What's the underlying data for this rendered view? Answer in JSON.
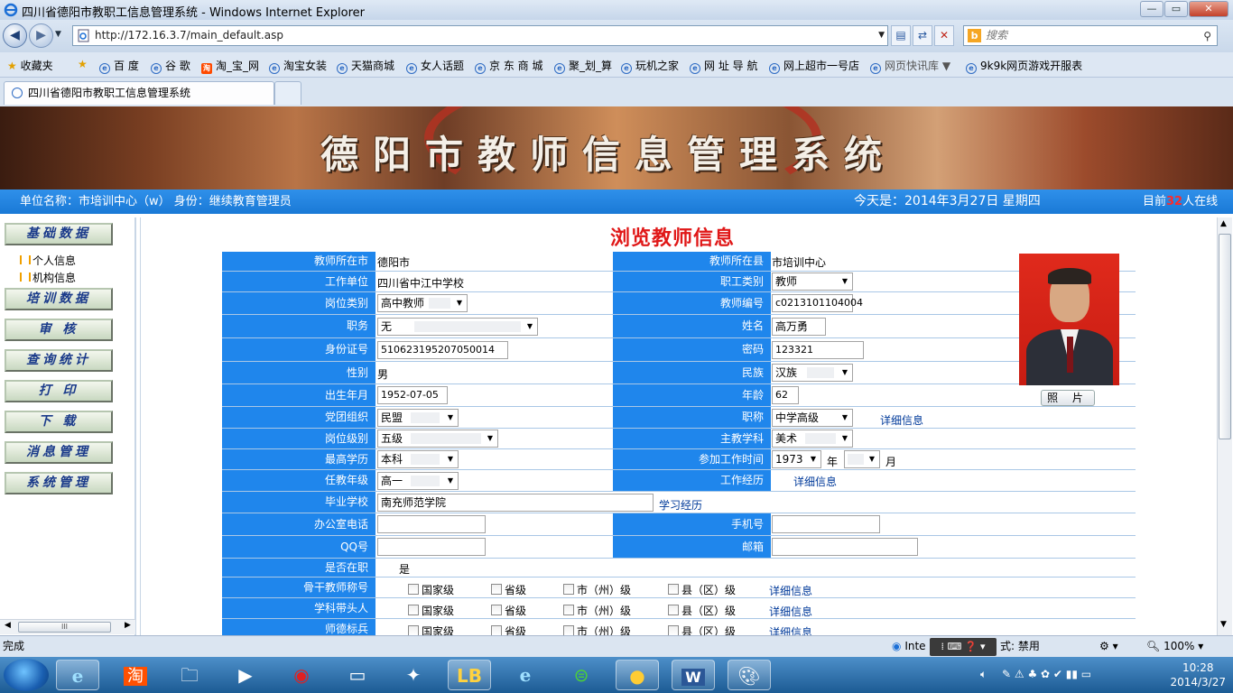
{
  "browser": {
    "window_title": "四川省德阳市教职工信息管理系统 - Windows Internet Explorer",
    "url": "http://172.16.3.7/main_default.asp",
    "search_placeholder": "搜索",
    "favorites_label": "收藏夹",
    "favorites": [
      "百 度",
      "谷 歌",
      "淘_宝_网",
      "淘宝女装",
      "天猫商城",
      "女人话题",
      "京 东 商 城",
      "聚_划_算",
      "玩机之家",
      "网 址 导 航",
      "网上超市一号店",
      "网页快讯库 ▼",
      "9k9k网页游戏开服表"
    ],
    "tab_title": "四川省德阳市教职工信息管理系统",
    "status_text": "完成",
    "zone_text": "Inte",
    "protected_mode": "式: 禁用",
    "zoom": "100%"
  },
  "banner": {
    "title": "德阳市教师信息管理系统"
  },
  "infobar": {
    "unit": "单位名称：市培训中心（w）   身份：继续教育管理员",
    "date": "今天是：2014年3月27日 星期四",
    "online_prefix": "目前",
    "online_count": "32",
    "online_suffix": "人在线"
  },
  "sidebar": {
    "buttons": [
      "基础数据",
      "培训数据",
      "审  核",
      "查询统计",
      "打  印",
      "下  载",
      "消息管理",
      "系统管理"
    ],
    "sub_items": [
      "个人信息",
      "机构信息"
    ]
  },
  "page": {
    "title": "浏览教师信息",
    "photo_button": "照 片",
    "fields": {
      "city_label": "教师所在市",
      "city": "德阳市",
      "county_label": "教师所在县",
      "county": "市培训中心",
      "work_unit_label": "工作单位",
      "work_unit": "四川省中江中学校",
      "staff_type_label": "职工类别",
      "staff_type": "教师",
      "post_type_label": "岗位类别",
      "post_type": "高中教师",
      "teacher_no_label": "教师编号",
      "teacher_no": "c0213101104004",
      "duty_label": "职务",
      "duty": "无",
      "name_label": "姓名",
      "name": "高万勇",
      "id_label": "身份证号",
      "id_no": "510623195207050014",
      "password_label": "密码",
      "password": "123321",
      "gender_label": "性别",
      "gender": "男",
      "ethnicity_label": "民族",
      "ethnicity": "汉族",
      "birth_label": "出生年月",
      "birth": "1952-07-05",
      "age_label": "年龄",
      "age": "62",
      "party_label": "党团组织",
      "party": "民盟",
      "title_label": "职称",
      "title_val": "中学高级",
      "title_detail": "详细信息",
      "post_level_label": "岗位级别",
      "post_level": "五级",
      "subject_label": "主教学科",
      "subject": "美术",
      "edu_label": "最高学历",
      "edu": "本科",
      "work_start_label": "参加工作时间",
      "work_start_year": "1973",
      "year_unit": "年",
      "work_start_month": "",
      "month_unit": "月",
      "grade_label": "任教年级",
      "grade": "高一",
      "work_exp_label": "工作经历",
      "work_exp_detail": "详细信息",
      "school_label": "毕业学校",
      "school": "南充师范学院",
      "study_exp": "学习经历",
      "office_phone_label": "办公室电话",
      "office_phone": "",
      "mobile_label": "手机号",
      "mobile": "",
      "qq_label": "QQ号",
      "qq": "",
      "email_label": "邮箱",
      "email": "",
      "on_job_label": "是否在职",
      "on_job": "是",
      "backbone_label": "骨干教师称号",
      "leader_label": "学科带头人",
      "model_label": "师德标兵",
      "levels": [
        "国家级",
        "省级",
        "市（州）级",
        "县（区）级"
      ],
      "detail": "详细信息"
    }
  },
  "taskbar": {
    "time": "10:28",
    "date": "2014/3/27"
  },
  "colors": {
    "label_bg": "#1f86ec",
    "title_red": "#e01818",
    "infobar": "#2388e8"
  }
}
